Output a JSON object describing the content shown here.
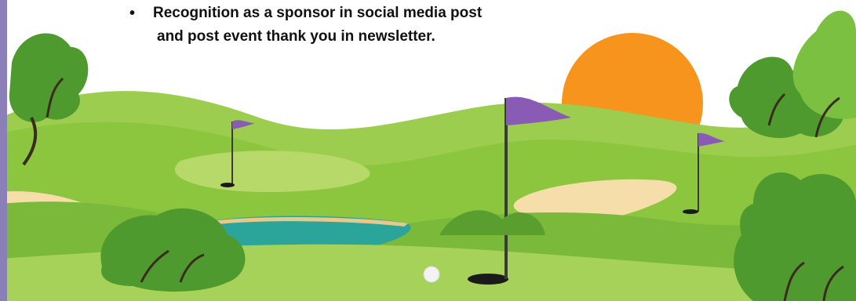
{
  "bullets": [
    {
      "marker": "•",
      "line1": "Recognition as a sponsor in social media post",
      "line2": "and post event thank you in newsletter."
    }
  ],
  "illustration": {
    "theme": "golf-course",
    "colors": {
      "sun": "#f7941d",
      "grass_light": "#b6d96a",
      "grass_mid": "#8cc63f",
      "grass_dark": "#5a9e2f",
      "tree": "#4e9a2f",
      "water": "#2ba59a",
      "sand": "#f6deab",
      "flag": "#8a5bb5",
      "side_strip": "#8b7fb8"
    },
    "icons": [
      "sun-icon",
      "flag-icon",
      "golf-ball-icon",
      "hole-icon",
      "tree-icon"
    ]
  }
}
